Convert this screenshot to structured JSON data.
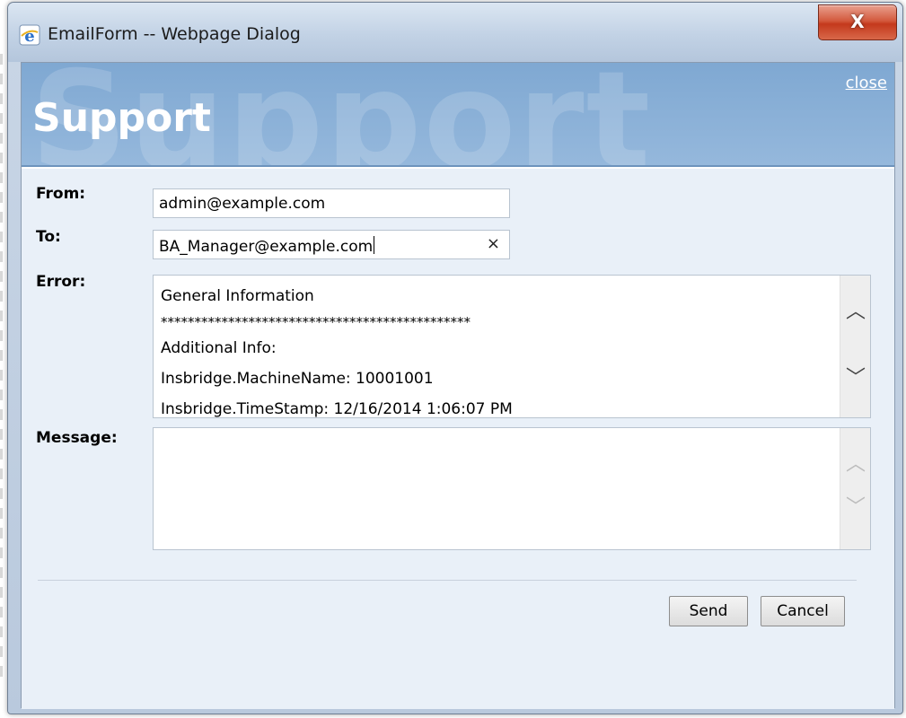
{
  "window": {
    "title": "EmailForm -- Webpage Dialog",
    "close_glyph": "X",
    "icon": "ie-icon"
  },
  "banner": {
    "title": "Support",
    "background_text": "Support",
    "close_link": "close"
  },
  "form": {
    "from": {
      "label": "From:",
      "value": "admin@example.com"
    },
    "to": {
      "label": "To:",
      "value": "BA_Manager@example.com",
      "clear_glyph": "×"
    },
    "error": {
      "label": "Error:",
      "lines": [
        "General Information",
        "**********************************************",
        "Additional Info:",
        "Insbridge.MachineName: 10001001",
        "Insbridge.TimeStamp: 12/16/2014 1:06:07 PM"
      ]
    },
    "message": {
      "label": "Message:",
      "value": ""
    }
  },
  "buttons": {
    "send": "Send",
    "cancel": "Cancel"
  },
  "colors": {
    "banner": "#8fb2d8",
    "form_bg": "#e9f0f8",
    "close_button": "#c4391c"
  }
}
